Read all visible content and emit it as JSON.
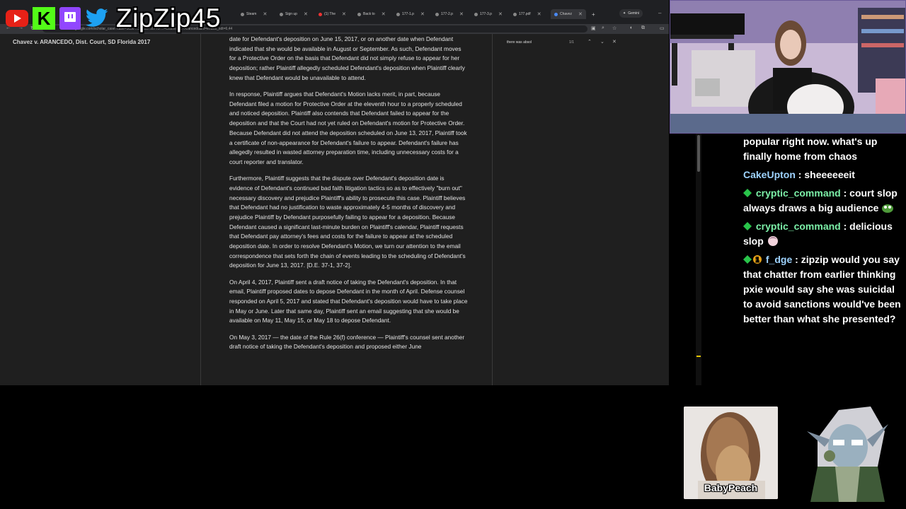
{
  "overlay": {
    "streamer_handle": "ZipZip45",
    "logos": [
      "youtube-logo",
      "kick-logo",
      "twitch-logo",
      "twitter-logo"
    ]
  },
  "browser": {
    "tabs": [
      {
        "label": "Steam",
        "icon": "steam-icon"
      },
      {
        "label": "Sign up",
        "icon": "tiktok-icon"
      },
      {
        "label": "(1) The",
        "icon": "youtube-icon"
      },
      {
        "label": "Back to",
        "icon": "kagi-icon"
      },
      {
        "label": "177-1.p",
        "icon": "link-icon"
      },
      {
        "label": "177-2.p",
        "icon": "link-icon"
      },
      {
        "label": "177-3.p",
        "icon": "link-icon"
      },
      {
        "label": "177.pdf",
        "icon": "link-icon"
      },
      {
        "label": "Chavez",
        "icon": "scholar-icon",
        "active": true
      }
    ],
    "gemini_label": "Gemini",
    "url": "...ar.google.com/scholar_case?case=5c36 ...2521871b775 ...=Chavez+v.+Arancedo&hl=en&as_sdt=6,44",
    "case_title": "Chavez v. ARANCEDO, Dist. Court, SD Florida 2017",
    "find": {
      "query": "there was absol",
      "count": "1/1"
    },
    "document_paragraphs": [
      "date for Defendant's deposition on June 15, 2017, or on another date when Defendant indicated that she would be available in August or September. As such, Defendant moves for a Protective Order on the basis that Defendant did not simply refuse to appear for her deposition; rather Plaintiff allegedly scheduled Defendant's deposition when Plaintiff clearly knew that Defendant would be unavailable to attend.",
      "In response, Plaintiff argues that Defendant's Motion lacks merit, in part, because Defendant filed a motion for Protective Order at the eleventh hour to a properly scheduled and noticed deposition. Plaintiff also contends that Defendant failed to appear for the deposition and that the Court had not yet ruled on Defendant's motion for Protective Order. Because Defendant did not attend the deposition scheduled on June 13, 2017, Plaintiff took a certificate of non-appearance for Defendant's failure to appear. Defendant's failure has allegedly resulted in wasted attorney preparation time, including unnecessary costs for a court reporter and translator.",
      "Furthermore, Plaintiff suggests that the dispute over Defendant's deposition date is evidence of Defendant's continued bad faith litigation tactics so as to effectively \"burn out\" necessary discovery and prejudice Plaintiff's ability to prosecute this case. Plaintiff believes that Defendant had no justification to waste approximately 4-5 months of discovery and prejudice Plaintiff by Defendant purposefully failing to appear for a deposition. Because Defendant caused a significant last-minute burden on Plaintiff's calendar, Plaintiff requests that Defendant pay attorney's fees and costs for the failure to appear at the scheduled deposition date. In order to resolve Defendant's Motion, we turn our attention to the email correspondence that sets forth the chain of events leading to the scheduling of Defendant's deposition for June 13, 2017. [D.E. 37-1, 37-2].",
      "On April 4, 2017, Plaintiff sent a draft notice of taking the Defendant's deposition. In that email, Plaintiff proposed dates to depose Defendant in the month of April. Defense counsel responded on April 5, 2017 and stated that Defendant's deposition would have to take place in May or June. Later that same day, Plaintiff sent an email suggesting that she would be available on May 11, May 15, or May 18 to depose Defendant.",
      "On May 3, 2017 — the date of the Rule 26(f) conference — Plaintiff's counsel sent another draft notice of taking the Defendant's deposition and proposed either June"
    ]
  },
  "chat": {
    "messages": [
      {
        "user": "",
        "text": "popular right now. what's up finally home from chaos",
        "user_color": "#ffffff",
        "badges": []
      },
      {
        "user": "CakeUpton",
        "text": "sheeeeeeit",
        "user_color": "#9ed3ff",
        "badges": []
      },
      {
        "user": "cryptic_command",
        "text": "court slop always draws a big audience",
        "user_color": "#7cf0a8",
        "badges": [
          "green-diamond-badge"
        ],
        "emote": "pepe-emote"
      },
      {
        "user": "cryptic_command",
        "text": "delicious slop",
        "user_color": "#7cf0a8",
        "badges": [
          "green-diamond-badge"
        ],
        "emote": "anime-girl-emote"
      },
      {
        "user": "f_dge",
        "text": "zipzip would you say that chatter from earlier thinking pxie would say she was suicidal to avoid sanctions would've been better than what she presented?",
        "user_color": "#9ed3ff",
        "badges": [
          "green-diamond-badge",
          "number-one-badge"
        ]
      }
    ],
    "separator": " : "
  },
  "avatars": {
    "babypeach_name": "BabyPeach"
  }
}
